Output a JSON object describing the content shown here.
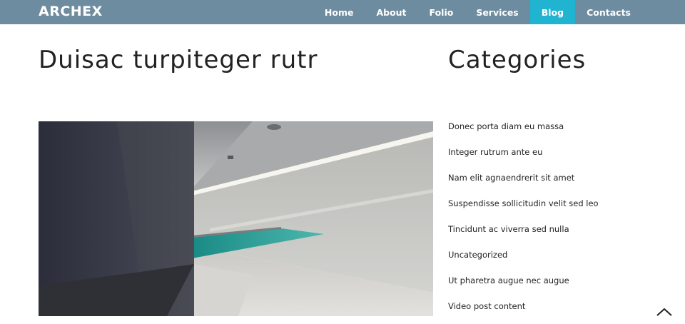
{
  "header": {
    "logo": "ARCHEX",
    "nav": [
      {
        "label": "Home"
      },
      {
        "label": "About"
      },
      {
        "label": "Folio"
      },
      {
        "label": "Services"
      },
      {
        "label": "Blog",
        "active": true
      },
      {
        "label": "Contacts"
      }
    ]
  },
  "post": {
    "title": "Duisac turpiteger rutr"
  },
  "sidebar": {
    "title": "Categories",
    "categories": [
      "Donec porta diam eu massa",
      "Integer rutrum ante eu",
      "Nam elit agnaendrerit sit amet",
      "Suspendisse sollicitudin velit sed leo",
      "Tincidunt ac viverra sed nulla",
      "Uncategorized",
      "Ut pharetra augue nec augue",
      "Video post content"
    ]
  },
  "colors": {
    "navbar": "#6e8c9f",
    "accent": "#20b4d1"
  },
  "icons": {
    "scroll_top": "chevron-up-icon"
  }
}
